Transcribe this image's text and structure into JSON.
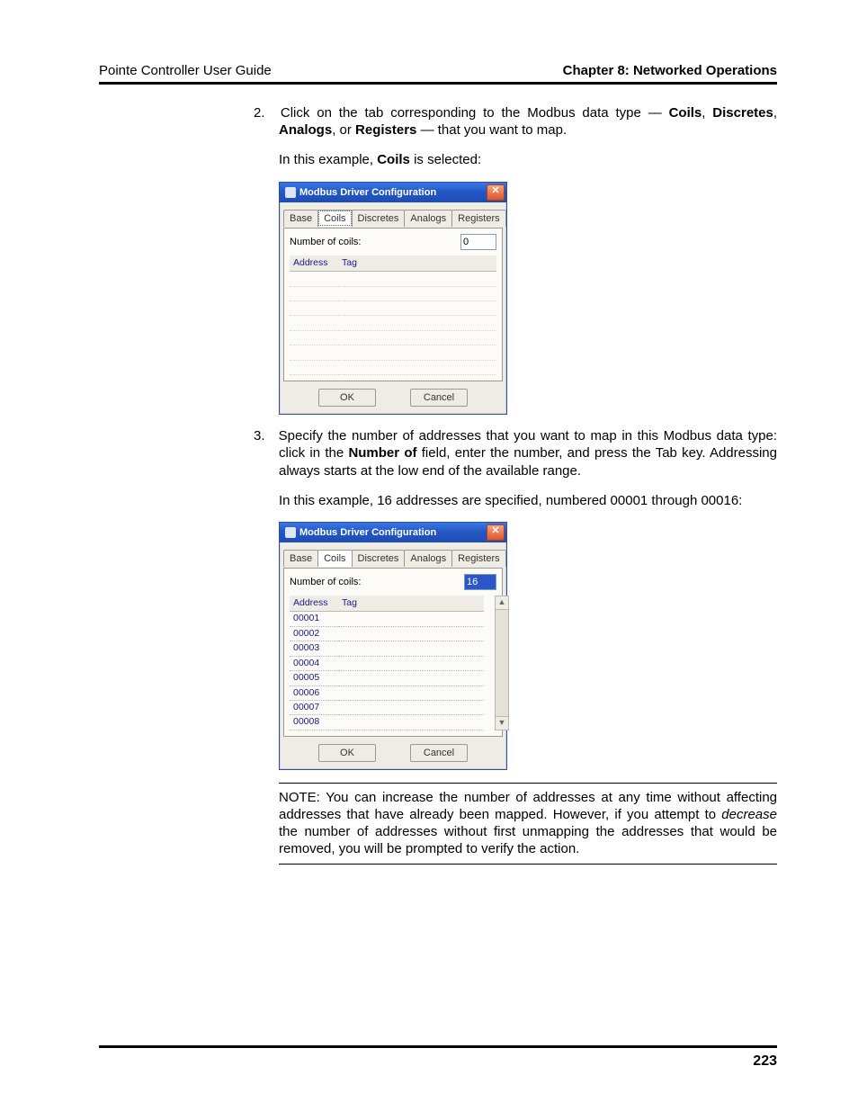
{
  "header": {
    "left": "Pointe Controller User Guide",
    "right": "Chapter 8: Networked Operations"
  },
  "steps": {
    "s2": {
      "num": "2.",
      "text_a": "Click on the tab corresponding to the Modbus data type — ",
      "b1": "Coils",
      "c1": ", ",
      "b2": "Discretes",
      "c2": ", ",
      "b3": "Analogs",
      "c3": ", or ",
      "b4": "Registers",
      "c4": " — that you want to map.",
      "follow_a": "In this example, ",
      "follow_b": "Coils",
      "follow_c": " is selected:"
    },
    "s3": {
      "num": "3.",
      "text_a": "Specify the number of addresses that you want to map in this Modbus data type: click in the ",
      "b1": "Number of",
      "text_b": " field, enter the number, and press the Tab key. Addressing always starts at the low end of the available range.",
      "follow": "In this example, 16 addresses are specified, numbered 00001 through 00016:"
    }
  },
  "dialog": {
    "title": "Modbus Driver Configuration",
    "tabs": [
      "Base",
      "Coils",
      "Discretes",
      "Analogs",
      "Registers"
    ],
    "field_label": "Number of coils:",
    "value1": "0",
    "value2": "16",
    "col_address": "Address",
    "col_tag": "Tag",
    "rows": [
      "00001",
      "00002",
      "00003",
      "00004",
      "00005",
      "00006",
      "00007",
      "00008"
    ],
    "ok": "OK",
    "cancel": "Cancel"
  },
  "note": {
    "a": "NOTE: You can increase the number of addresses at any time without affecting addresses that have already been mapped. However, if you attempt to ",
    "i": "decrease",
    "b": " the number of addresses without first unmapping the addresses that would be removed, you will be prompted to verify the action."
  },
  "page_number": "223"
}
